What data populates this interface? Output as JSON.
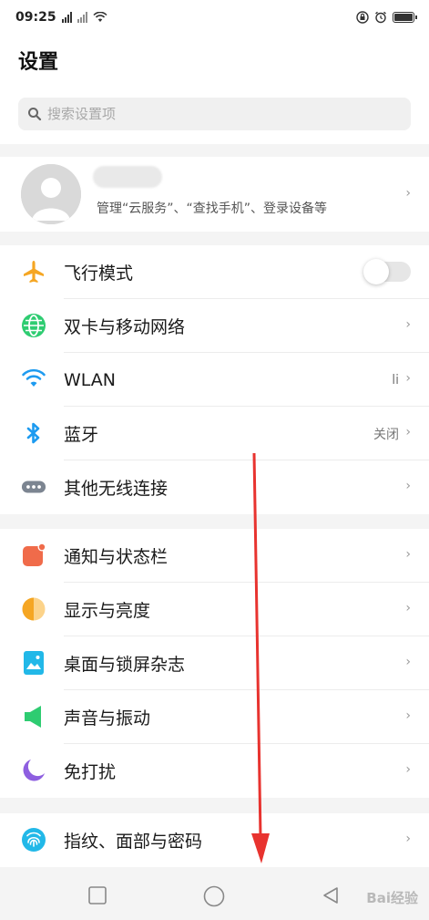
{
  "status_bar": {
    "time": "09:25",
    "colors": {
      "text": "#222222"
    },
    "icons": [
      "signal-icon",
      "signal-icon",
      "wifi-icon",
      "lock-rotation-icon",
      "alarm-icon",
      "battery-icon"
    ]
  },
  "header": {
    "title": "设置"
  },
  "search": {
    "placeholder": "搜索设置项",
    "icon": "search-icon"
  },
  "account": {
    "subtitle": "管理“云服务”、“查找手机”、登录设备等",
    "avatar_icon": "user-avatar-icon"
  },
  "groups": [
    {
      "items": [
        {
          "label": "飞行模式",
          "icon": "airplane-icon",
          "color": "#f5a623",
          "control": "toggle",
          "toggle_on": false
        },
        {
          "label": "双卡与移动网络",
          "icon": "globe-icon",
          "color": "#2ecc71",
          "control": "chevron"
        },
        {
          "label": "WLAN",
          "icon": "wifi-icon",
          "color": "#1e9bf0",
          "value": "li",
          "control": "chevron"
        },
        {
          "label": "蓝牙",
          "icon": "bluetooth-icon",
          "color": "#1e9bf0",
          "value": "关闭",
          "control": "chevron"
        },
        {
          "label": "其他无线连接",
          "icon": "more-dots-icon",
          "color": "#7c8591",
          "control": "chevron"
        }
      ]
    },
    {
      "items": [
        {
          "label": "通知与状态栏",
          "icon": "notification-icon",
          "color": "#f06b4a",
          "control": "chevron"
        },
        {
          "label": "显示与亮度",
          "icon": "brightness-icon",
          "color": "#f5a623",
          "control": "chevron"
        },
        {
          "label": "桌面与锁屏杂志",
          "icon": "wallpaper-icon",
          "color": "#22b8e8",
          "control": "chevron"
        },
        {
          "label": "声音与振动",
          "icon": "speaker-icon",
          "color": "#2ecc71",
          "control": "chevron"
        },
        {
          "label": "免打扰",
          "icon": "moon-icon",
          "color": "#8e5fe0",
          "control": "chevron"
        }
      ]
    },
    {
      "items": [
        {
          "label": "指纹、面部与密码",
          "icon": "fingerprint-icon",
          "color": "#22b8e8",
          "control": "chevron"
        }
      ]
    }
  ],
  "chevron": "›",
  "nav_bar": {
    "buttons": [
      "recent-apps-icon",
      "home-icon",
      "back-icon"
    ]
  },
  "annotation": {
    "arrow_color": "#e8332f"
  },
  "watermark": {
    "text": "Bai经验"
  }
}
